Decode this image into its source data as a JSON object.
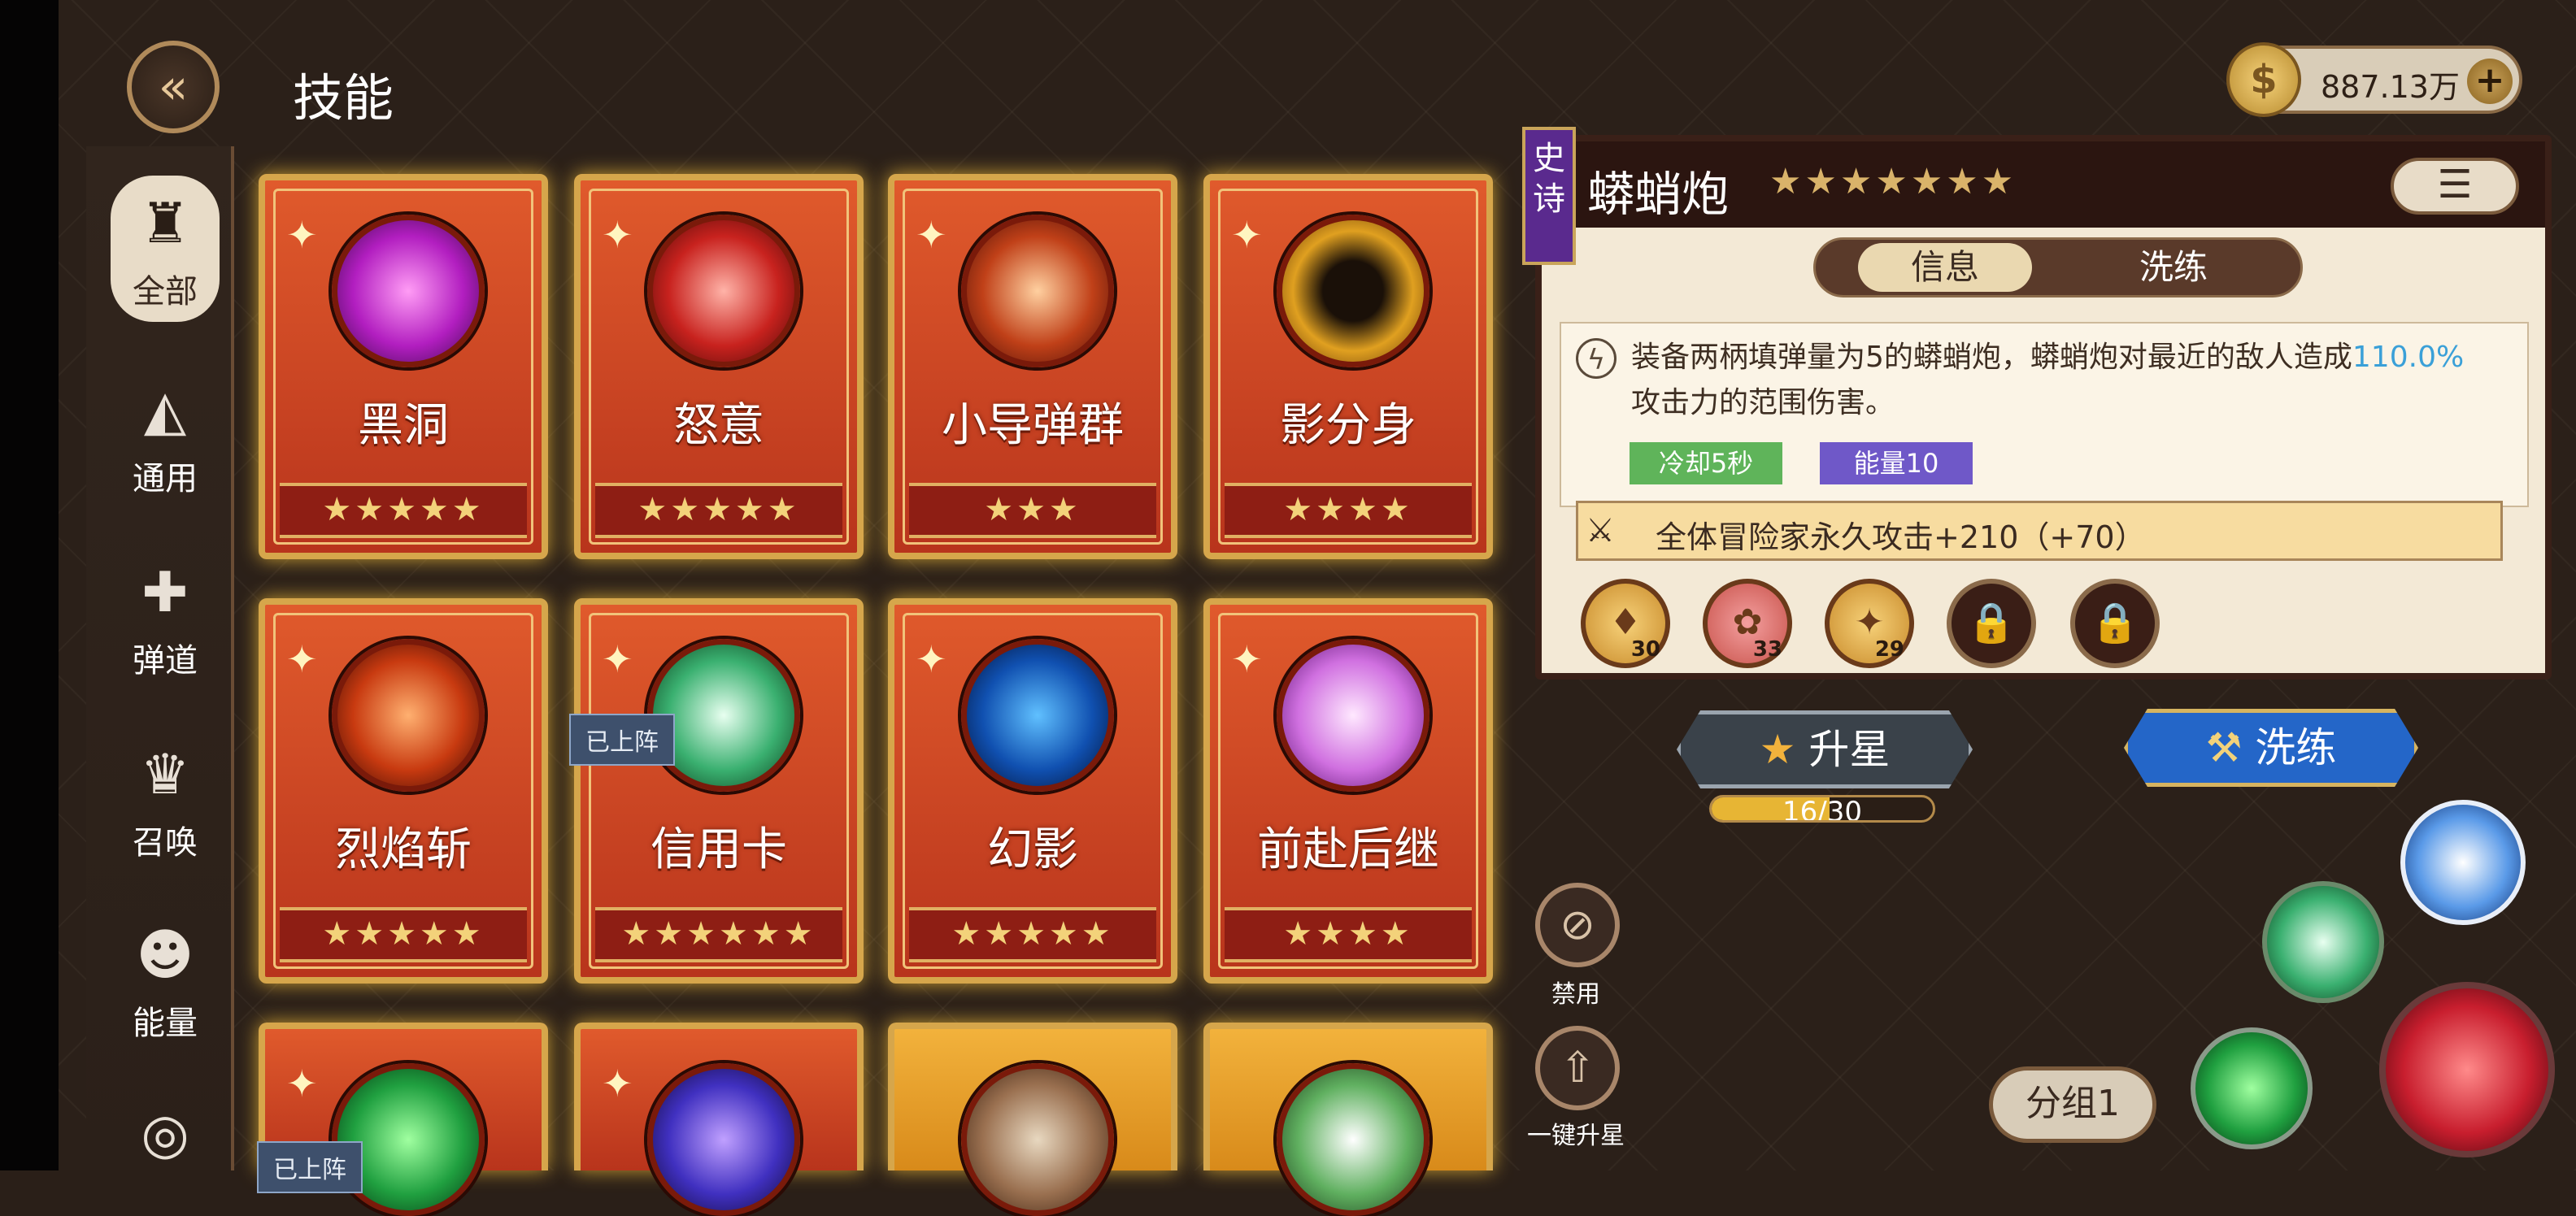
{
  "header": {
    "title": "技能",
    "back_icon": "back-arrow-icon"
  },
  "currency": {
    "amount": "887.13万",
    "plus": "+"
  },
  "sidebar": {
    "items": [
      {
        "label": "全部",
        "icon": "♜"
      },
      {
        "label": "通用",
        "icon": "◭"
      },
      {
        "label": "弹道",
        "icon": "✚"
      },
      {
        "label": "召唤",
        "icon": "♛"
      },
      {
        "label": "能量",
        "icon": "☻"
      }
    ]
  },
  "cards": [
    {
      "name": "黑洞",
      "stars": "★★★★★"
    },
    {
      "name": "怒意",
      "stars": "★★★★★"
    },
    {
      "name": "小导弹群",
      "stars": "★★★"
    },
    {
      "name": "影分身",
      "stars": "★★★★"
    },
    {
      "name": "烈焰斩",
      "stars": "★★★★★"
    },
    {
      "name": "信用卡",
      "stars": "★★★★★★",
      "badge": "已上阵"
    },
    {
      "name": "幻影",
      "stars": "★★★★★"
    },
    {
      "name": "前赴后继",
      "stars": "★★★★"
    }
  ],
  "bottom_badge": "已上阵",
  "detail": {
    "rarity": "史诗",
    "title": "蟒蛸炮",
    "stars": "★★★★★★★",
    "tabs": [
      "信息",
      "洗练"
    ],
    "description_pre": "装备两柄填弹量为5的蟒蛸炮，蟒蛸炮对最近的敌人造成",
    "description_highlight": "110.0%",
    "description_post": "攻击力的范围伤害。",
    "cooldown": "冷却5秒",
    "energy": "能量10",
    "bonus": "全体冒险家永久攻击+210（+70）",
    "runes": [
      {
        "level": "30",
        "symbol": "♦"
      },
      {
        "level": "33",
        "symbol": "✿"
      },
      {
        "level": "29",
        "symbol": "✦"
      }
    ],
    "lock_icon": "🔒"
  },
  "actions": {
    "upgrade_label": "升星",
    "progress_text": "16/30",
    "progress_value": 0.533,
    "refine_label": "洗练"
  },
  "controls": {
    "disable_label": "禁用",
    "onekey_label": "一键升星",
    "group_label": "分组1"
  },
  "colors": {
    "accent_gold": "#d6a64b",
    "card_red": "#c8401e",
    "epic_purple": "#5a2a8e",
    "highlight": "#3aa0d8"
  }
}
